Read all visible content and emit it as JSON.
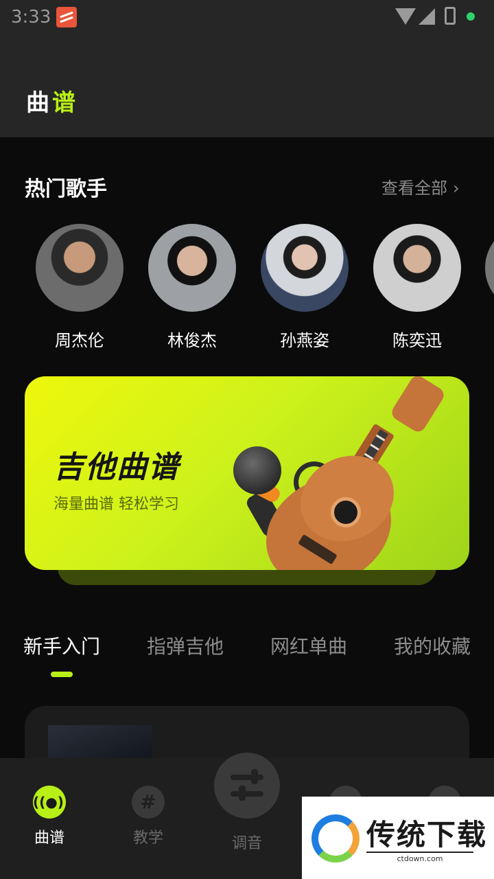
{
  "status_bar": {
    "time": "3:33"
  },
  "header": {
    "title_part1": "曲",
    "title_part2": "谱"
  },
  "hot_singers": {
    "title": "热门歌手",
    "see_all": "查看全部",
    "singers": [
      {
        "name": "周杰伦"
      },
      {
        "name": "林俊杰"
      },
      {
        "name": "孙燕姿"
      },
      {
        "name": "陈奕迅"
      }
    ]
  },
  "banner": {
    "title": "吉他曲谱",
    "subtitle": "海量曲谱 轻松学习"
  },
  "tabs": [
    {
      "label": "新手入门",
      "active": true
    },
    {
      "label": "指弹吉他",
      "active": false
    },
    {
      "label": "网红单曲",
      "active": false
    },
    {
      "label": "我的收藏",
      "active": false
    }
  ],
  "bottom_nav": {
    "items": [
      {
        "label": "曲谱",
        "icon": "vinyl-icon",
        "active": true
      },
      {
        "label": "教学",
        "icon": "hash-icon",
        "active": false
      },
      {
        "label": "调音",
        "icon": "tuner-sliders-icon",
        "active": false
      }
    ]
  },
  "watermark": {
    "text": "传统下载",
    "url": "ctdown.com"
  },
  "colors": {
    "accent": "#b8ef16",
    "background": "#0b0b0b",
    "header_bg": "#262626"
  }
}
